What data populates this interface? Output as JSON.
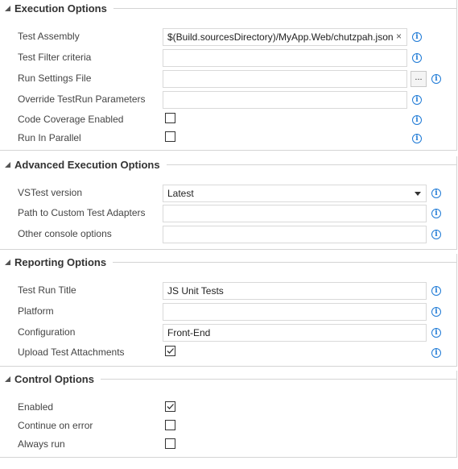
{
  "execution": {
    "title": "Execution Options",
    "test_assembly_label": "Test Assembly",
    "test_assembly_value": "$(Build.sourcesDirectory)/MyApp.Web/chutzpah.json",
    "clear_glyph": "×",
    "test_filter_label": "Test Filter criteria",
    "test_filter_value": "",
    "run_settings_label": "Run Settings File",
    "run_settings_value": "",
    "browse_label": "...",
    "override_label": "Override TestRun Parameters",
    "override_value": "",
    "code_coverage_label": "Code Coverage Enabled",
    "code_coverage_checked": false,
    "run_parallel_label": "Run In Parallel",
    "run_parallel_checked": false
  },
  "advanced": {
    "title": "Advanced Execution Options",
    "vstest_label": "VSTest version",
    "vstest_value": "Latest",
    "adapters_label": "Path to Custom Test Adapters",
    "adapters_value": "",
    "console_label": "Other console options",
    "console_value": ""
  },
  "reporting": {
    "title": "Reporting Options",
    "run_title_label": "Test Run Title",
    "run_title_value": "JS Unit Tests",
    "platform_label": "Platform",
    "platform_value": "",
    "configuration_label": "Configuration",
    "configuration_value": "Front-End",
    "upload_label": "Upload Test Attachments",
    "upload_checked": true
  },
  "control": {
    "title": "Control Options",
    "enabled_label": "Enabled",
    "enabled_checked": true,
    "continue_label": "Continue on error",
    "continue_checked": false,
    "always_label": "Always run",
    "always_checked": false
  },
  "icons": {
    "info_glyph": "i",
    "section_chevron": "chevron-down-icon",
    "info_icon": "info-icon",
    "check_icon": "checkmark-icon"
  },
  "colors": {
    "accent": "#1e7ad6",
    "border": "#d4d4d4",
    "text": "#333333"
  }
}
